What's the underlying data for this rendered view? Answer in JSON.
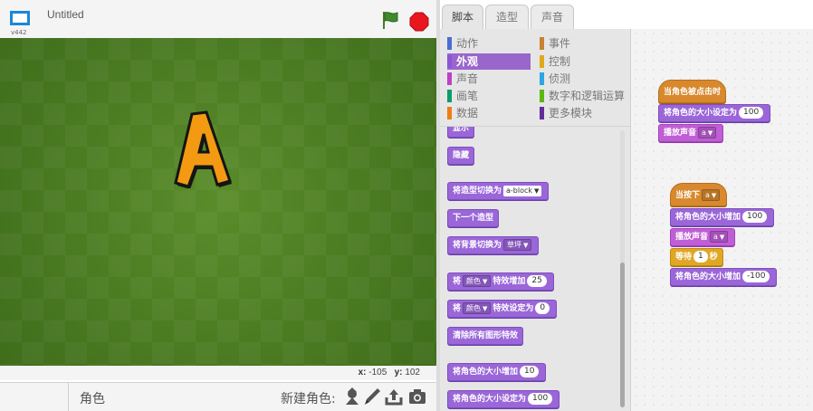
{
  "stage": {
    "title": "Untitled",
    "version": "v442",
    "sprite_letter": "A",
    "coords": {
      "x_label": "x:",
      "x_value": "-105",
      "y_label": "y:",
      "y_value": "102"
    }
  },
  "sprite_panel": {
    "sprite_label": "角色",
    "new_sprite_label": "新建角色:"
  },
  "tabs": [
    {
      "label": "脚本",
      "active": true
    },
    {
      "label": "造型",
      "active": false
    },
    {
      "label": "声音",
      "active": false
    }
  ],
  "categories": [
    {
      "label": "动作",
      "color": "#4a6cd4"
    },
    {
      "label": "事件",
      "color": "#c88330"
    },
    {
      "label": "外观",
      "color": "#8a55d7",
      "selected": true
    },
    {
      "label": "控制",
      "color": "#e1a91a"
    },
    {
      "label": "声音",
      "color": "#bb42c3"
    },
    {
      "label": "侦测",
      "color": "#2ca5e2"
    },
    {
      "label": "画笔",
      "color": "#0e9a6c"
    },
    {
      "label": "数字和逻辑运算",
      "color": "#5cb712"
    },
    {
      "label": "数据",
      "color": "#ee7d16"
    },
    {
      "label": "更多模块",
      "color": "#632d99"
    }
  ],
  "palette_blocks": {
    "show": "显示",
    "hide": "隐藏",
    "switch_costume": {
      "text": "将造型切换为",
      "value": "a-block"
    },
    "next_costume": "下一个造型",
    "switch_backdrop": {
      "text": "将背景切换为",
      "value": "草坪"
    },
    "change_effect": {
      "prefix": "将",
      "effect": "颜色",
      "text": "特效增加",
      "value": "25"
    },
    "set_effect": {
      "prefix": "将",
      "effect": "颜色",
      "text": "特效设定为",
      "value": "0"
    },
    "clear_effects": "清除所有图形特效",
    "change_size": {
      "text": "将角色的大小增加",
      "value": "10"
    },
    "set_size": {
      "text": "将角色的大小设定为",
      "value": "100"
    }
  },
  "scripts": {
    "script1": {
      "hat": "当角色被点击时",
      "set_size": {
        "text": "将角色的大小设定为",
        "value": "100"
      },
      "play_sound": {
        "text": "播放声音",
        "value": "a"
      }
    },
    "script2": {
      "hat": {
        "text": "当按下",
        "value": "a"
      },
      "change_size": {
        "text": "将角色的大小增加",
        "value": "100"
      },
      "play_sound": {
        "text": "播放声音",
        "value": "a"
      },
      "wait": {
        "text": "等待",
        "value": "1",
        "unit": "秒"
      },
      "change_size2": {
        "text": "将角色的大小增加",
        "value": "-100"
      }
    }
  }
}
